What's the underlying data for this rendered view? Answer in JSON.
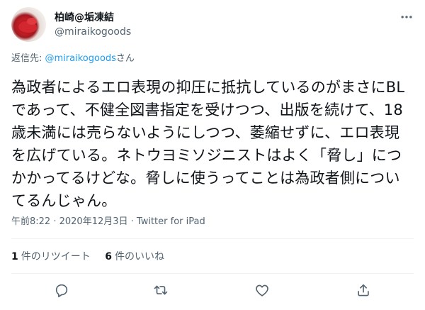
{
  "author": {
    "display_name": "柏崎@垢凍結",
    "handle": "@miraikogoods"
  },
  "reply_context": {
    "prefix": "返信先: ",
    "target": "@miraikogoods",
    "suffix": "さん"
  },
  "tweet": {
    "text": "為政者によるエロ表現の抑圧に抵抗しているのがまさにBLであって、不健全図書指定を受けつつ、出版を続けて、18歳未満には売らないようにしつつ、萎縮せずに、エロ表現を広げている。ネトウヨミソジニストはよく「脅し」につかかってるけどな。脅しに使うってことは為政者側についてるんじゃん。",
    "time": "午前8:22",
    "separator": " · ",
    "date": "2020年12月3日",
    "client": "Twitter for iPad"
  },
  "stats": {
    "retweets": {
      "count": "1",
      "label": "件のリツイート"
    },
    "likes": {
      "count": "6",
      "label": "件のいいね"
    }
  },
  "icons": {
    "more": "more-dots-icon",
    "reply": "reply-bubble-icon",
    "retweet": "retweet-arrows-icon",
    "like": "heart-icon",
    "share": "share-upload-icon"
  },
  "colors": {
    "text": "#0f1419",
    "secondary": "#536471",
    "link": "#1d9bf0",
    "divider": "#eff3f4"
  }
}
